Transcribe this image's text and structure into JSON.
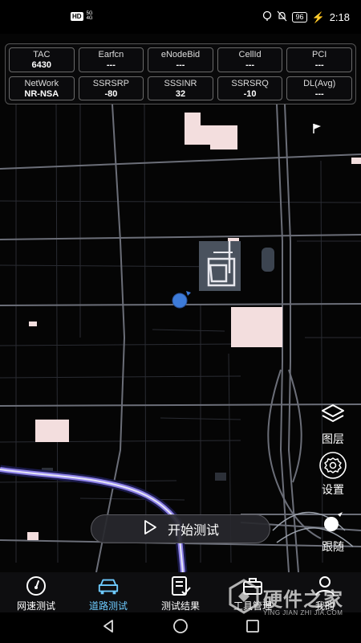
{
  "status_bar": {
    "hd_badge": "HD",
    "net_top": "5G",
    "net_bottom": "4G",
    "battery": "96",
    "time": "2:18"
  },
  "info_panel": {
    "cells": [
      {
        "label": "TAC",
        "value": "6430"
      },
      {
        "label": "Earfcn",
        "value": "---"
      },
      {
        "label": "eNodeBid",
        "value": "---"
      },
      {
        "label": "CellId",
        "value": "---"
      },
      {
        "label": "PCI",
        "value": "---"
      },
      {
        "label": "NetWork",
        "value": "NR-NSA"
      },
      {
        "label": "SSRSRP",
        "value": "-80"
      },
      {
        "label": "SSSINR",
        "value": "32"
      },
      {
        "label": "SSRSRQ",
        "value": "-10"
      },
      {
        "label": "DL(Avg)",
        "value": "---"
      }
    ]
  },
  "controls": {
    "layers_label": "图层",
    "settings_label": "设置",
    "follow_label": "跟随"
  },
  "start_button": {
    "label": "开始测试"
  },
  "bottom_nav": {
    "items": [
      {
        "label": "网速测试",
        "icon": "speedometer-icon"
      },
      {
        "label": "道路测试",
        "icon": "car-icon",
        "active": true
      },
      {
        "label": "测试结果",
        "icon": "checklist-icon"
      },
      {
        "label": "工具管理",
        "icon": "toolbox-icon"
      },
      {
        "label": "我的",
        "icon": "person-icon"
      }
    ]
  },
  "watermark": {
    "title": "硬件之家",
    "subtitle": "YING JIAN ZHI JIA.COM"
  },
  "colors": {
    "active_tab": "#6ecbff",
    "location_dot": "#3d7bd9",
    "route": "#8e82e8",
    "building": "#f3dede"
  }
}
